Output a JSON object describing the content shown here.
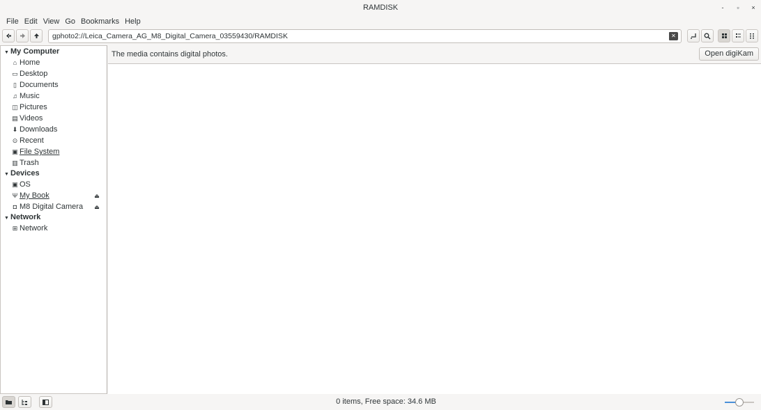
{
  "window": {
    "title": "RAMDISK",
    "controls": [
      "-",
      "▫",
      "×"
    ]
  },
  "menubar": [
    "File",
    "Edit",
    "View",
    "Go",
    "Bookmarks",
    "Help"
  ],
  "toolbar": {
    "back_glyph": "◆",
    "forward_glyph": "➜",
    "up_glyph": "⬆",
    "location_value": "gphoto2://Leica_Camera_AG_M8_Digital_Camera_03559430/RAMDISK",
    "clear_glyph": "✕",
    "toggle_location_glyph": "⌐",
    "search_glyph": "⌕",
    "icon_view_glyph": "▪▪",
    "list_view_glyph": "☰",
    "compact_view_glyph": "⁝⁝"
  },
  "sidebar": {
    "sections": [
      {
        "label": "My Computer",
        "items": [
          {
            "label": "Home",
            "icon": "⌂"
          },
          {
            "label": "Desktop",
            "icon": "▭"
          },
          {
            "label": "Documents",
            "icon": "▯"
          },
          {
            "label": "Music",
            "icon": "♫"
          },
          {
            "label": "Pictures",
            "icon": "◫"
          },
          {
            "label": "Videos",
            "icon": "▤"
          },
          {
            "label": "Downloads",
            "icon": "⬇"
          },
          {
            "label": "Recent",
            "icon": "⊙"
          },
          {
            "label": "File System",
            "icon": "▣"
          },
          {
            "label": "Trash",
            "icon": "▥"
          }
        ]
      },
      {
        "label": "Devices",
        "items": [
          {
            "label": "OS",
            "icon": "▣"
          },
          {
            "label": "My Book",
            "icon": "Ψ"
          },
          {
            "label": "M8 Digital Camera",
            "icon": "◘"
          }
        ]
      },
      {
        "label": "Network",
        "items": [
          {
            "label": "Network",
            "icon": "⊞"
          }
        ]
      }
    ],
    "expander_glyph": "▼",
    "eject_glyph": "⏏"
  },
  "infobar": {
    "message": "The media contains digital photos.",
    "button_label": "Open digiKam"
  },
  "status": {
    "text": "0 items, Free space: 34.6 MB",
    "places_glyph": "▬",
    "tree_glyph": "⊢",
    "hide_sidebar_glyph": "◧",
    "zoom_level": 0.5
  },
  "colors": {
    "accent": "#4a90d9",
    "background": "#f6f5f4",
    "view": "#ffffff"
  }
}
